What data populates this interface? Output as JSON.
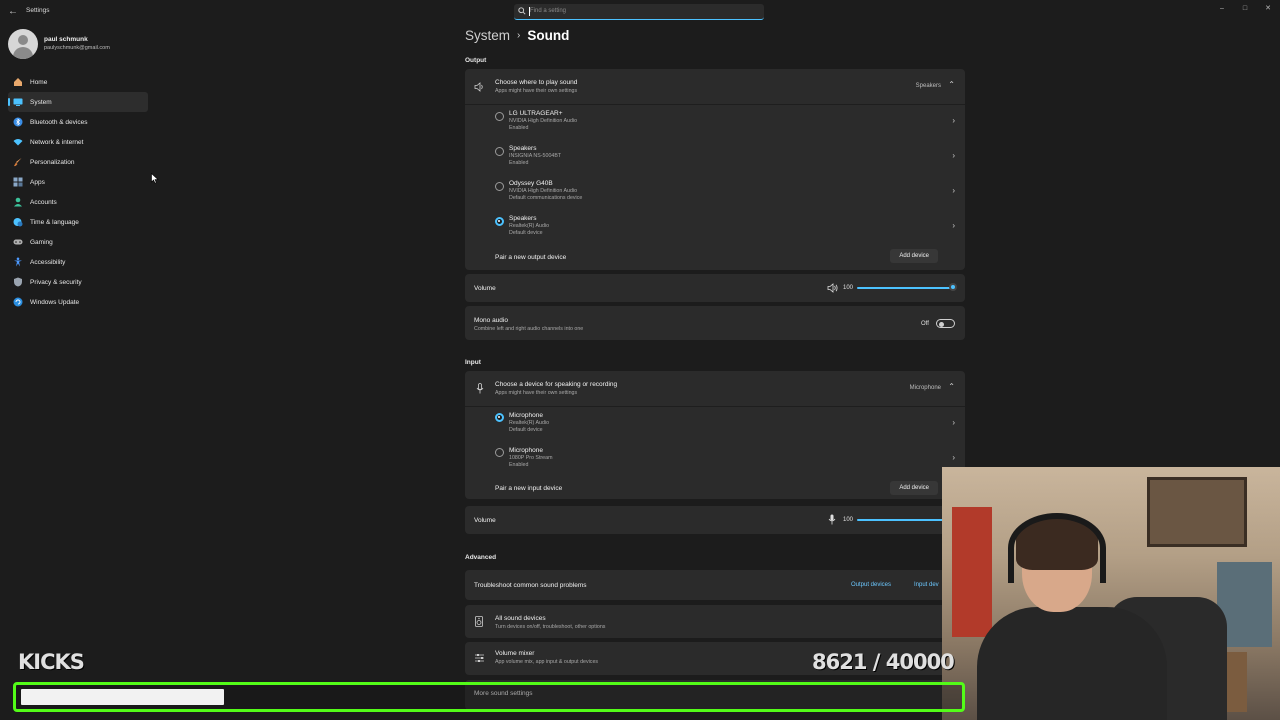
{
  "window": {
    "title": "Settings"
  },
  "search": {
    "placeholder": "Find a setting"
  },
  "profile": {
    "name": "paul schmunk",
    "email": "paulyschmunk@gmail.com"
  },
  "sidebar": {
    "items": [
      {
        "label": "Home",
        "icon": "home-icon",
        "color": "#e8a86c"
      },
      {
        "label": "System",
        "icon": "monitor-icon",
        "color": "#4cc2ff"
      },
      {
        "label": "Bluetooth & devices",
        "icon": "bluetooth-icon",
        "color": "#3a8ee6"
      },
      {
        "label": "Network & internet",
        "icon": "wifi-icon",
        "color": "#4cc2ff"
      },
      {
        "label": "Personalization",
        "icon": "brush-icon",
        "color": "#e59a5b"
      },
      {
        "label": "Apps",
        "icon": "apps-icon",
        "color": "#8aa8c8"
      },
      {
        "label": "Accounts",
        "icon": "person-icon",
        "color": "#3cc29a"
      },
      {
        "label": "Time & language",
        "icon": "globe-clock-icon",
        "color": "#4cc2ff"
      },
      {
        "label": "Gaming",
        "icon": "gamepad-icon",
        "color": "#b0b0b0"
      },
      {
        "label": "Accessibility",
        "icon": "accessibility-icon",
        "color": "#4c9aff"
      },
      {
        "label": "Privacy & security",
        "icon": "shield-icon",
        "color": "#9aa4b0"
      },
      {
        "label": "Windows Update",
        "icon": "update-icon",
        "color": "#2a8ee0"
      }
    ],
    "active_index": 1
  },
  "breadcrumb": {
    "parent": "System",
    "separator": "›",
    "current": "Sound"
  },
  "output": {
    "section_label": "Output",
    "header": {
      "title": "Choose where to play sound",
      "subtitle": "Apps might have their own settings",
      "selected": "Speakers"
    },
    "devices": [
      {
        "name": "LG ULTRAGEAR+",
        "driver": "NVIDIA High Definition Audio",
        "status": "Enabled",
        "selected": false
      },
      {
        "name": "Speakers",
        "driver": "INSIGNIA NS-5004BT",
        "status": "Enabled",
        "selected": false
      },
      {
        "name": "Odyssey G40B",
        "driver": "NVIDIA High Definition Audio",
        "status": "Default communications device",
        "selected": false
      },
      {
        "name": "Speakers",
        "driver": "Realtek(R) Audio",
        "status": "Default device",
        "selected": true
      }
    ],
    "pair_label": "Pair a new output device",
    "add_label": "Add device",
    "volume_label": "Volume",
    "volume_value": "100",
    "volume_fraction": 1.0,
    "mono": {
      "title": "Mono audio",
      "subtitle": "Combine left and right audio channels into one",
      "state": "Off"
    }
  },
  "input": {
    "section_label": "Input",
    "header": {
      "title": "Choose a device for speaking or recording",
      "subtitle": "Apps might have their own settings",
      "selected": "Microphone"
    },
    "devices": [
      {
        "name": "Microphone",
        "driver": "Realtek(R) Audio",
        "status": "Default device",
        "selected": true
      },
      {
        "name": "Microphone",
        "driver": "1080P Pro Stream",
        "status": "Enabled",
        "selected": false
      }
    ],
    "pair_label": "Pair a new input device",
    "add_label": "Add device",
    "volume_label": "Volume",
    "volume_value": "100",
    "volume_fraction": 1.0
  },
  "advanced": {
    "section_label": "Advanced",
    "troubleshoot": {
      "title": "Troubleshoot common sound problems",
      "link1": "Output devices",
      "link2": "Input dev"
    },
    "all_devices": {
      "title": "All sound devices",
      "subtitle": "Turn devices on/off, troubleshoot, other options"
    },
    "mixer": {
      "title": "Volume mixer",
      "subtitle": "App volume mix, app input & output devices"
    },
    "more": {
      "title": "More sound settings"
    }
  },
  "overlay": {
    "kicks_label": "KICKS",
    "goal_text": "8621  / 40000",
    "goal_current": 8621,
    "goal_target": 40000,
    "accent_color": "#53fc18"
  }
}
